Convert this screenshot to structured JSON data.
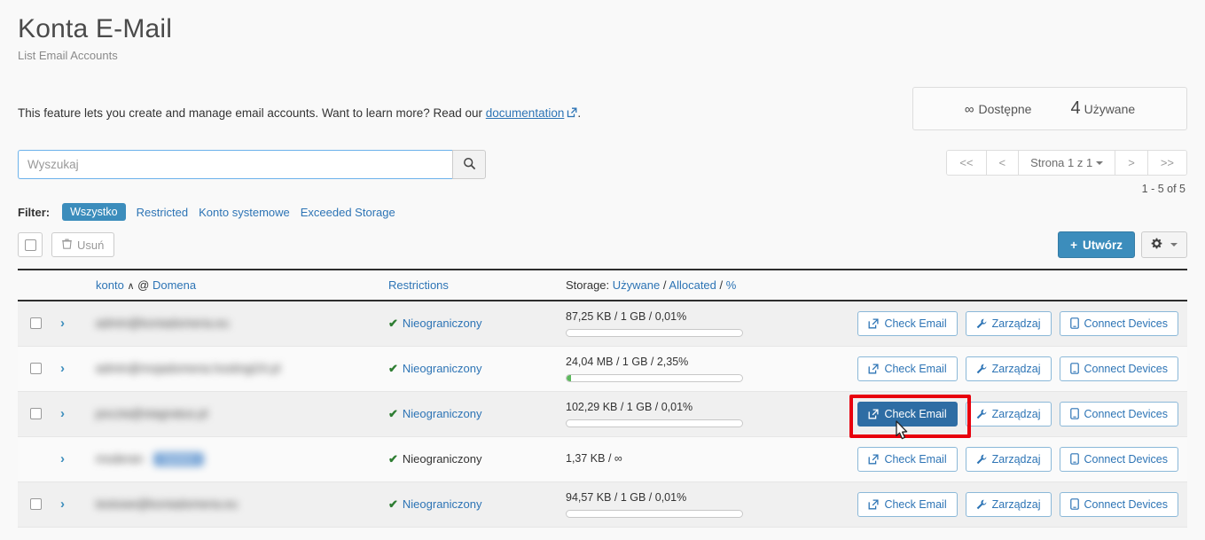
{
  "header": {
    "title": "Konta E-Mail",
    "subtitle": "List Email Accounts",
    "intro_before": "This feature lets you create and manage email accounts. Want to learn more? Read our ",
    "intro_link": "documentation",
    "intro_after": "."
  },
  "stats": {
    "available_value": "∞",
    "available_label": "Dostępne",
    "used_value": "4",
    "used_label": "Używane"
  },
  "search": {
    "placeholder": "Wyszukaj",
    "value": "",
    "button_icon": "search-icon"
  },
  "filter": {
    "label": "Filter:",
    "items": [
      {
        "label": "Wszystko",
        "active": true
      },
      {
        "label": "Restricted",
        "active": false
      },
      {
        "label": "Konto systemowe",
        "active": false
      },
      {
        "label": "Exceeded Storage",
        "active": false
      }
    ]
  },
  "pagination": {
    "first": "<<",
    "prev": "<",
    "page_label": "Strona 1 z 1",
    "next": ">",
    "last": ">>",
    "count": "1 - 5 of 5"
  },
  "actions": {
    "delete_label": "Usuń",
    "create_label": "Utwórz",
    "create_plus": "+",
    "gear_icon": "gear-icon"
  },
  "table": {
    "headers": {
      "account": "konto",
      "account_sort": "∧",
      "account_at": "@",
      "domain": "Domena",
      "restrictions": "Restrictions",
      "storage_prefix": "Storage:",
      "storage_used": "Używane",
      "storage_sep1": "/",
      "storage_allocated": "Allocated",
      "storage_sep2": "/",
      "storage_percent": "%"
    },
    "rows": [
      {
        "has_checkbox": true,
        "email": "admin@koniadomena.eu",
        "badge": null,
        "restriction": "Nieograniczony",
        "restriction_is_link": true,
        "storage": "87,25 KB / 1 GB / 0,01%",
        "storage_percent": 0.01,
        "show_bar": true,
        "buttons": [
          "Check Email",
          "Zarządzaj",
          "Connect Devices"
        ],
        "hovered_button": null
      },
      {
        "has_checkbox": true,
        "email": "admin@mojadomena.hostingi24.pl",
        "badge": null,
        "restriction": "Nieograniczony",
        "restriction_is_link": true,
        "storage": "24,04 MB / 1 GB / 2,35%",
        "storage_percent": 2.35,
        "show_bar": true,
        "buttons": [
          "Check Email",
          "Zarządzaj",
          "Connect Devices"
        ],
        "hovered_button": null
      },
      {
        "has_checkbox": true,
        "email": "poczta@stagnatus.pl",
        "badge": null,
        "restriction": "Nieograniczony",
        "restriction_is_link": true,
        "storage": "102,29 KB / 1 GB / 0,01%",
        "storage_percent": 0.01,
        "show_bar": true,
        "buttons": [
          "Check Email",
          "Zarządzaj",
          "Connect Devices"
        ],
        "hovered_button": "Check Email"
      },
      {
        "has_checkbox": false,
        "email": "moderan",
        "badge": "System",
        "restriction": "Nieograniczony",
        "restriction_is_link": false,
        "storage": "1,37 KB / ∞",
        "storage_percent": 0,
        "show_bar": false,
        "buttons": [
          "Check Email",
          "Zarządzaj",
          "Connect Devices"
        ],
        "hovered_button": null
      },
      {
        "has_checkbox": true,
        "email": "testowe@koniadomena.eu",
        "badge": null,
        "restriction": "Nieograniczony",
        "restriction_is_link": true,
        "storage": "94,57 KB / 1 GB / 0,01%",
        "storage_percent": 0.01,
        "show_bar": true,
        "buttons": [
          "Check Email",
          "Zarządzaj",
          "Connect Devices"
        ],
        "hovered_button": null
      }
    ]
  },
  "colors": {
    "accent_blue": "#3c8dbc",
    "link_blue": "#2d74b5",
    "hover_button": "#2e6da4",
    "progress_green": "#5cb85c",
    "annotation_red": "#e8000d",
    "check_green": "#2e7d32"
  }
}
